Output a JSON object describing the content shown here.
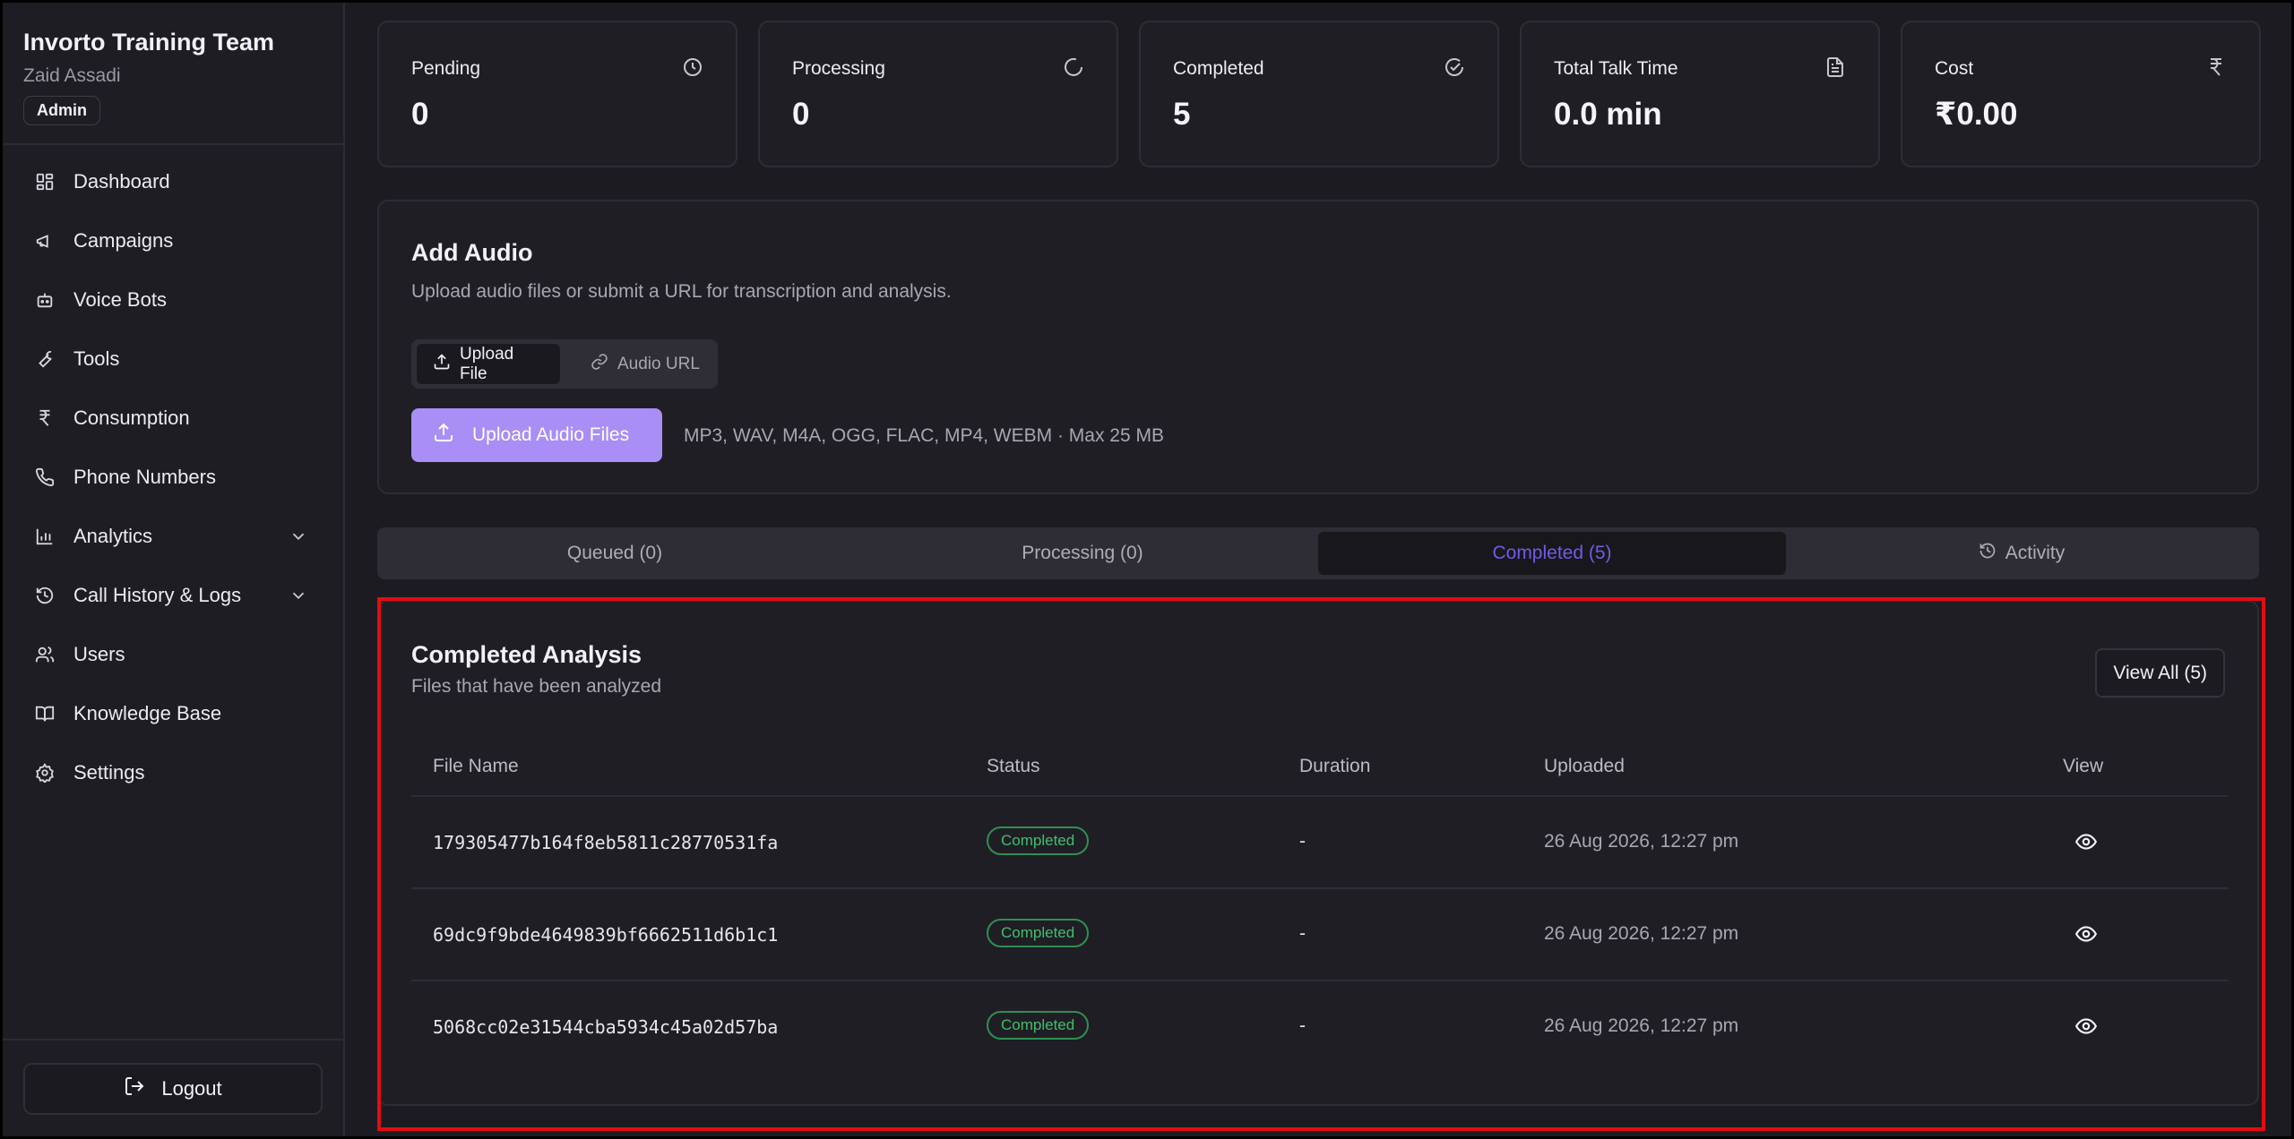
{
  "sidebar": {
    "team_name": "Invorto Training Team",
    "user_name": "Zaid Assadi",
    "role": "Admin",
    "items": [
      {
        "label": "Dashboard",
        "icon": "dashboard-icon"
      },
      {
        "label": "Campaigns",
        "icon": "megaphone-icon"
      },
      {
        "label": "Voice Bots",
        "icon": "bot-icon"
      },
      {
        "label": "Tools",
        "icon": "wrench-icon"
      },
      {
        "label": "Consumption",
        "icon": "rupee-icon"
      },
      {
        "label": "Phone Numbers",
        "icon": "phone-icon"
      },
      {
        "label": "Analytics",
        "icon": "bar-chart-icon"
      },
      {
        "label": "Call History & Logs",
        "icon": "history-icon"
      },
      {
        "label": "Users",
        "icon": "users-icon"
      },
      {
        "label": "Knowledge Base",
        "icon": "book-icon"
      },
      {
        "label": "Settings",
        "icon": "gear-icon"
      }
    ],
    "logout_label": "Logout"
  },
  "stats": [
    {
      "label": "Pending",
      "value": "0",
      "icon": "clock-icon"
    },
    {
      "label": "Processing",
      "value": "0",
      "icon": "spinner-icon"
    },
    {
      "label": "Completed",
      "value": "5",
      "icon": "check-circle-icon"
    },
    {
      "label": "Total Talk Time",
      "value": "0.0 min",
      "icon": "document-icon"
    },
    {
      "label": "Cost",
      "value": "₹0.00",
      "icon": "rupee-icon"
    }
  ],
  "add_audio": {
    "title": "Add Audio",
    "description": "Upload audio files or submit a URL for transcription and analysis.",
    "tab_upload": "Upload File",
    "tab_url": "Audio URL",
    "upload_button": "Upload Audio Files",
    "formats": "MP3, WAV, M4A, OGG, FLAC, MP4, WEBM · Max 25 MB"
  },
  "tabs": {
    "queued": "Queued (0)",
    "processing": "Processing (0)",
    "completed": "Completed (5)",
    "activity": "Activity"
  },
  "results": {
    "title": "Completed Analysis",
    "subtitle": "Files that have been analyzed",
    "view_all": "View All (5)",
    "columns": {
      "file_name": "File Name",
      "status": "Status",
      "duration": "Duration",
      "uploaded": "Uploaded",
      "view": "View"
    },
    "rows": [
      {
        "file_name": "179305477b164f8eb5811c28770531fa",
        "status": "Completed",
        "duration": "-",
        "uploaded": "26 Aug 2026, 12:27 pm"
      },
      {
        "file_name": "69dc9f9bde4649839bf6662511d6b1c1",
        "status": "Completed",
        "duration": "-",
        "uploaded": "26 Aug 2026, 12:27 pm"
      },
      {
        "file_name": "5068cc02e31544cba5934c45a02d57ba",
        "status": "Completed",
        "duration": "-",
        "uploaded": "26 Aug 2026, 12:27 pm"
      }
    ]
  },
  "colors": {
    "accent": "#6f5ce8",
    "upload_button": "#a98ef5",
    "status_completed": "#3fbf6a",
    "highlight": "#e10d13"
  }
}
